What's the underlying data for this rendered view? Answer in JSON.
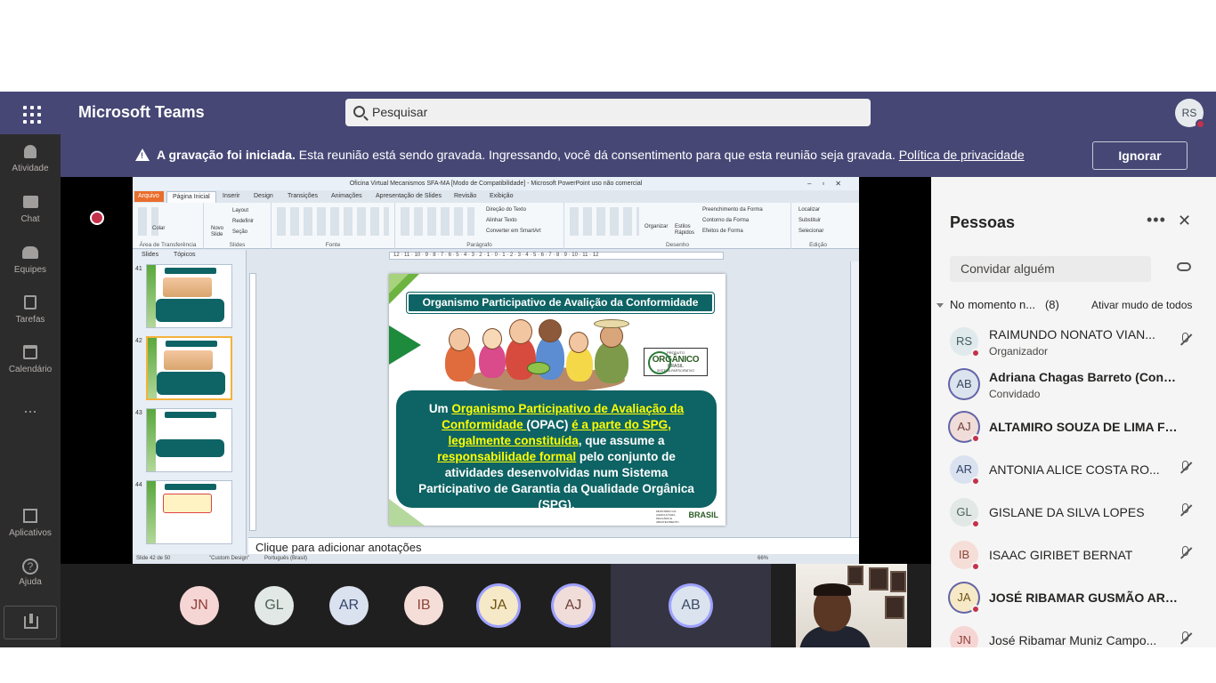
{
  "app": {
    "title": "Microsoft Teams",
    "search_placeholder": "Pesquisar",
    "user_initials": "RS"
  },
  "rail": [
    {
      "label": "Atividade",
      "icon": "bell-icon"
    },
    {
      "label": "Chat",
      "icon": "chat-icon"
    },
    {
      "label": "Equipes",
      "icon": "teams-icon"
    },
    {
      "label": "Tarefas",
      "icon": "tasks-icon"
    },
    {
      "label": "Calendário",
      "icon": "calendar-icon"
    },
    {
      "label": "...",
      "icon": "more-icon"
    },
    {
      "label": "Aplicativos",
      "icon": "apps-icon"
    },
    {
      "label": "Ajuda",
      "icon": "help-icon"
    }
  ],
  "banner": {
    "bold": "A gravação foi iniciada.",
    "text": " Esta reunião está sendo gravada. Ingressando, você dá consentimento para que esta reunião seja gravada. ",
    "link": "Política de privacidade",
    "button": "Ignorar",
    "accent": "#464775"
  },
  "ppt": {
    "window_title": "Oficina Virtual Mecanismos SFA-MA [Modo de Compatibilidade] - Microsoft PowerPoint uso não comercial",
    "tabs": [
      "Arquivo",
      "Página Inicial",
      "Inserir",
      "Design",
      "Transições",
      "Animações",
      "Apresentação de Slides",
      "Revisão",
      "Exibição"
    ],
    "groups": [
      "Área de Transferência",
      "Slides",
      "Fonte",
      "Parágrafo",
      "Desenho",
      "Edição"
    ],
    "ribbon_labels": [
      "Colar",
      "Novo Slide",
      "Layout",
      "Redefinir",
      "Seção",
      "Direção do Texto",
      "Alinhar Texto",
      "Converter em SmartArt",
      "Organizar",
      "Estilos Rápidos",
      "Preenchimento da Forma",
      "Contorno da Forma",
      "Efeitos de Forma",
      "Localizar",
      "Substituir",
      "Selecionar"
    ],
    "pane_tabs": [
      "Slides",
      "Tópicos"
    ],
    "thumbs": [
      {
        "num": "41",
        "title": "Responsabilidade Solidária"
      },
      {
        "num": "42",
        "title": "Organismo Participativo de Avaliação da Conformidade"
      },
      {
        "num": "43",
        "title": "Sistema Participativo de Garantia - SPG"
      },
      {
        "num": "44",
        "title": "Características do OPAC"
      }
    ],
    "ruler": "12 · 11 · 10 · 9 · 8 · 7 · 6 · 5 · 4 · 3 · 2 · 1 · 0 · 1 · 2 · 3 · 4 · 5 · 6 · 7 · 8 · 9 · 10 · 11 · 12",
    "notes_placeholder": "Clique para adicionar anotações",
    "status_slide": "Slide 42 de 50",
    "status_theme": "\"Custom Design\"",
    "status_lang": "Português (Brasil)",
    "status_zoom": "66%",
    "slide": {
      "title": "Organismo Participativo de Avalição da Conformidade",
      "t1": "Um ",
      "h1": "Organismo Participativo de Avaliação da Conformidade ",
      "t2": "(OPAC) ",
      "h2": "é a parte do SPG, legalmente constituída",
      "t3": ", que assume a ",
      "h3": "responsabilidade formal",
      "t4": " pelo conjunto de atividades desenvolvidas num Sistema Participativo de Garantia da Qualidade Orgânica (SPG).",
      "logo_top": "PRODUTO",
      "logo_big": "ORGÂNICO",
      "logo_sub": "BRASIL",
      "logo_small": "SISTEMA PARTICIPATIVO",
      "footer_ministry": "MINISTÉRIO DA AGRICULTURA, PECUÁRIA E ABASTECIMENTO",
      "footer_country": "BRASIL",
      "teal": "#0e6364",
      "highlight": "#ffff00"
    }
  },
  "strip": {
    "avatars": [
      {
        "initials": "JN",
        "bg": "#f6d6d4",
        "fg": "#8f3e3a",
        "ring": false
      },
      {
        "initials": "GL",
        "bg": "#e1e8e6",
        "fg": "#4f6357",
        "ring": false
      },
      {
        "initials": "AR",
        "bg": "#dae2ef",
        "fg": "#33446b",
        "ring": false
      },
      {
        "initials": "IB",
        "bg": "#f5ddd8",
        "fg": "#8e4537",
        "ring": false
      },
      {
        "initials": "JA",
        "bg": "#f6e9c7",
        "fg": "#6e5313",
        "ring": true
      },
      {
        "initials": "AJ",
        "bg": "#f0ddd9",
        "fg": "#6f3d36",
        "ring": true
      }
    ],
    "speaker": {
      "initials": "AB",
      "bg": "#dbe3ee",
      "fg": "#3b4a63"
    }
  },
  "panel": {
    "title": "Pessoas",
    "invite_placeholder": "Convidar alguém",
    "section_label": "No momento n...",
    "section_count": "(8)",
    "mute_all": "Ativar mudo de todos",
    "people": [
      {
        "initials": "RS",
        "name": "RAIMUNDO NONATO VIAN...",
        "role": "Organizador",
        "bold": false,
        "bg": "#e0eaec",
        "fg": "#3f5c60",
        "dot": true,
        "mic": true,
        "ring": false
      },
      {
        "initials": "AB",
        "name": "Adriana Chagas Barreto (Convi...",
        "role": "Convidado",
        "bold": true,
        "bg": "#dbe3ee",
        "fg": "#3b4a63",
        "dot": false,
        "mic": false,
        "ring": true
      },
      {
        "initials": "AJ",
        "name": "ALTAMIRO SOUZA DE LIMA FE...",
        "role": "",
        "bold": true,
        "bg": "#f0ddd9",
        "fg": "#6f3d36",
        "dot": true,
        "mic": false,
        "ring": true
      },
      {
        "initials": "AR",
        "name": "ANTONIA ALICE COSTA RO...",
        "role": "",
        "bold": false,
        "bg": "#dae2ef",
        "fg": "#33446b",
        "dot": true,
        "mic": true,
        "ring": false
      },
      {
        "initials": "GL",
        "name": "GISLANE DA SILVA LOPES",
        "role": "",
        "bold": false,
        "bg": "#e1e8e6",
        "fg": "#4f6357",
        "dot": true,
        "mic": true,
        "ring": false
      },
      {
        "initials": "IB",
        "name": "ISAAC GIRIBET BERNAT",
        "role": "",
        "bold": false,
        "bg": "#f5ddd8",
        "fg": "#8e4537",
        "dot": true,
        "mic": true,
        "ring": false
      },
      {
        "initials": "JA",
        "name": "JOSÉ RIBAMAR GUSMÃO ARA...",
        "role": "",
        "bold": true,
        "bg": "#f6e9c7",
        "fg": "#6e5313",
        "dot": true,
        "mic": false,
        "ring": true
      },
      {
        "initials": "JN",
        "name": "José Ribamar Muniz Campo...",
        "role": "",
        "bold": false,
        "bg": "#f6d6d4",
        "fg": "#8f3e3a",
        "dot": false,
        "mic": true,
        "ring": false
      }
    ]
  }
}
